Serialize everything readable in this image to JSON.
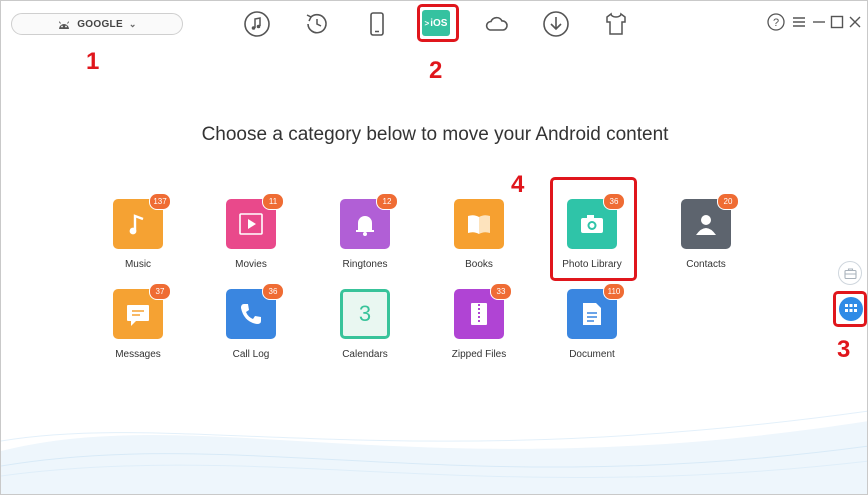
{
  "device": {
    "name": "GOOGLE"
  },
  "toolbar": {
    "icons": [
      "music-note-icon",
      "history-icon",
      "phone-icon",
      "android-to-ios-icon",
      "cloud-icon",
      "download-icon",
      "tshirt-icon"
    ],
    "ios_label": "iOS"
  },
  "window": {
    "controls": [
      "help-icon",
      "menu-icon",
      "minimize-icon",
      "maximize-icon",
      "close-icon"
    ]
  },
  "heading": "Choose a category below to move your Android content",
  "categories": [
    {
      "label": "Music",
      "count": "137",
      "color": "#f5a233",
      "icon": "music-icon"
    },
    {
      "label": "Movies",
      "count": "11",
      "color": "#e9498b",
      "icon": "movie-icon"
    },
    {
      "label": "Ringtones",
      "count": "12",
      "color": "#b15fd6",
      "icon": "bell-icon"
    },
    {
      "label": "Books",
      "count": "",
      "color": "#f6a030",
      "icon": "book-icon"
    },
    {
      "label": "Photo Library",
      "count": "36",
      "color": "#2fc4a8",
      "icon": "camera-icon"
    },
    {
      "label": "Contacts",
      "count": "20",
      "color": "#5d646e",
      "icon": "contact-icon"
    },
    {
      "label": "Messages",
      "count": "37",
      "color": "#f5a233",
      "icon": "message-icon"
    },
    {
      "label": "Call Log",
      "count": "36",
      "color": "#3a86e0",
      "icon": "phone-call-icon"
    },
    {
      "label": "Calendars",
      "count": "",
      "color": "#38c39a",
      "icon": "calendar-icon",
      "calendar_day": "3"
    },
    {
      "label": "Zipped Files",
      "count": "33",
      "color": "#b044d4",
      "icon": "zip-icon"
    },
    {
      "label": "Document",
      "count": "110",
      "color": "#3a86e0",
      "icon": "document-icon"
    }
  ],
  "annotations": [
    "1",
    "2",
    "3",
    "4"
  ],
  "colors": {
    "accent_red": "#e0161c",
    "badge": "#ef6c34",
    "ios_green": "#35c2a0",
    "side_blue": "#2f8be6"
  }
}
